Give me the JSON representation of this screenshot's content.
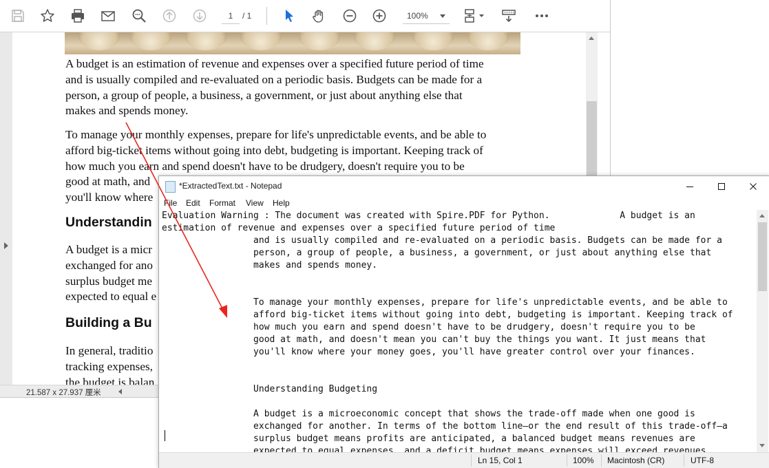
{
  "pdf_viewer": {
    "toolbar": {
      "page_current": "1",
      "page_total": "/ 1",
      "zoom": "100%"
    },
    "content": {
      "para1": [
        "A budget is an estimation of revenue and expenses over a specified future period of time",
        "and is usually compiled and re-evaluated on a periodic basis. Budgets can be made for a",
        "person, a group of people, a business, a government, or just about anything else that",
        "makes and spends money."
      ],
      "para2": [
        "To manage your monthly expenses, prepare for life's unpredictable events, and be able to",
        "afford big-ticket items without going into debt, budgeting is important. Keeping track of",
        "how much you earn and spend doesn't have to be drudgery, doesn't require you to be",
        "good at math, and",
        "you'll know where"
      ],
      "heading1": "Understandin",
      "para3": [
        "A budget is a micr",
        "exchanged for ano",
        "surplus budget me",
        "expected to equal e"
      ],
      "heading2": "Building a Bu",
      "para4": [
        "In general, traditio",
        "tracking expenses,",
        "the budget is balan"
      ]
    },
    "status": {
      "size": "21.587 x 27.937 厘米"
    }
  },
  "notepad": {
    "title": "*ExtractedText.txt - Notepad",
    "menu": [
      "File",
      "Edit",
      "Format",
      "View",
      "Help"
    ],
    "text": "Evaluation Warning : The document was created with Spire.PDF for Python.             A budget is an\nestimation of revenue and expenses over a specified future period of time\n                 and is usually compiled and re-evaluated on a periodic basis. Budgets can be made for a\n                 person, a group of people, a business, a government, or just about anything else that\n                 makes and spends money.\n\n\n                 To manage your monthly expenses, prepare for life's unpredictable events, and be able to\n                 afford big-ticket items without going into debt, budgeting is important. Keeping track of\n                 how much you earn and spend doesn't have to be drudgery, doesn't require you to be\n                 good at math, and doesn't mean you can't buy the things you want. It just means that\n                 you'll know where your money goes, you'll have greater control over your finances.\n\n\n                 Understanding Budgeting\n\n                 A budget is a microeconomic concept that shows the trade-off made when one good is\n                 exchanged for another. In terms of the bottom line—or the end result of this trade-off—a\n                 surplus budget means profits are anticipated, a balanced budget means revenues are\n                 expected to equal expenses, and a deficit budget means expenses will exceed revenues.",
    "status": {
      "position": "Ln 15, Col 1",
      "zoom": "100%",
      "line_ending": "Macintosh (CR)",
      "encoding": "UTF-8"
    }
  },
  "icons": {
    "pdf_toolbar": [
      "save-icon",
      "star-icon",
      "print-icon",
      "mail-icon",
      "zoom-search-icon",
      "page-up-icon",
      "page-down-icon",
      "select-pointer-icon",
      "hand-icon",
      "zoom-out-icon",
      "zoom-in-icon",
      "fit-page-icon",
      "read-mode-icon",
      "more-icon"
    ],
    "notepad_window": [
      "minimize-icon",
      "maximize-icon",
      "close-icon"
    ]
  },
  "colors": {
    "accent_blue": "#1e6fd9",
    "annotation_arrow": "#e8261f"
  }
}
